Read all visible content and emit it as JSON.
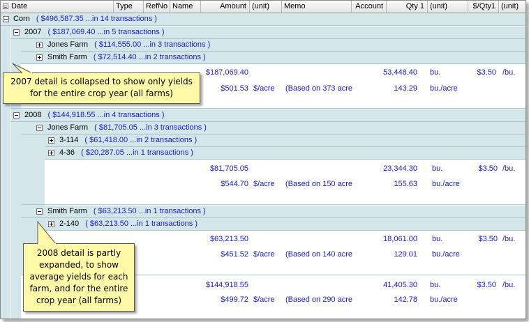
{
  "header": {
    "date": "Date",
    "type": "Type",
    "refno": "RefNo",
    "name": "Name",
    "amount": "Amount",
    "amount_unit": "(unit)",
    "memo": "Memo",
    "account": "Account",
    "qty1": "Qty 1",
    "qty1_unit": "(unit)",
    "per_qty1": "$/Qty1",
    "per_qty1_unit": "(unit)"
  },
  "groups": {
    "corn": {
      "name": "Corn",
      "summary": "( $496,587.35  ...in 14 transactions )"
    },
    "y2007": {
      "name": "2007",
      "summary": "( $187,069.40  ...in 5 transactions )"
    },
    "jones2007": {
      "name": "Jones Farm",
      "summary": "( $114,555.00  ...in 3 transactions )"
    },
    "smith2007": {
      "name": "Smith Farm",
      "summary": "( $72,514.40  ...in 2 transactions )"
    },
    "y2008": {
      "name": "2008",
      "summary": "( $144,918.55  ...in 4 transactions )"
    },
    "jones2008": {
      "name": "Jones Farm",
      "summary": "( $81,705.05  ...in 3 transactions )"
    },
    "f3114": {
      "name": "3-114",
      "summary": "( $61,418.00  ...in 2 transactions )"
    },
    "f436": {
      "name": "4-36",
      "summary": "( $20,287.05  ...in 1 transactions )"
    },
    "smith2008": {
      "name": "Smith Farm",
      "summary": "( $63,213.50  ...in 1 transactions )"
    },
    "f2140": {
      "name": "2-140",
      "summary": "( $63,213.50  ...in 1 transactions )"
    }
  },
  "totals": {
    "y2007": {
      "amount": "$187,069.40",
      "qty": "53,448.40",
      "qty_unit": "bu.",
      "price": "$3.50",
      "price_unit": "/bu.",
      "per_acre": "$501.53",
      "per_acre_unit": "$/acre",
      "memo": "(Based on 373 acre",
      "yield": "143.29",
      "yield_unit": "bu./acre"
    },
    "jones2008": {
      "amount": "$81,705.05",
      "qty": "23,344.30",
      "qty_unit": "bu.",
      "price": "$3.50",
      "price_unit": "/bu.",
      "per_acre": "$544.70",
      "per_acre_unit": "$/acre",
      "memo": "(Based on 150 acre",
      "yield": "155.63",
      "yield_unit": "bu./acre"
    },
    "smith2008": {
      "amount": "$63,213.50",
      "qty": "18,061.00",
      "qty_unit": "bu.",
      "price": "$3.50",
      "price_unit": "/bu.",
      "per_acre": "$451.52",
      "per_acre_unit": "$/acre",
      "memo": "(Based on 140 acre",
      "yield": "129.01",
      "yield_unit": "bu./acre"
    },
    "y2008": {
      "amount": "$144,918.55",
      "qty": "41,405.30",
      "qty_unit": "bu.",
      "price": "$3.50",
      "price_unit": "/bu.",
      "per_acre": "$499.72",
      "per_acre_unit": "$/acre",
      "memo": "(Based on 290 acre",
      "yield": "142.78",
      "yield_unit": "bu./acre"
    }
  },
  "callouts": {
    "c2007": "2007 detail is collapsed to show only yields for the entire crop year (all farms)",
    "c2008": "2008 detail is partly expanded, to show average yields for each farm, and for the entire crop year (all farms)"
  },
  "colors": {
    "band": "#d4e6ea",
    "value_text": "#1a1acc",
    "callout_fill": "#fff9a8"
  }
}
